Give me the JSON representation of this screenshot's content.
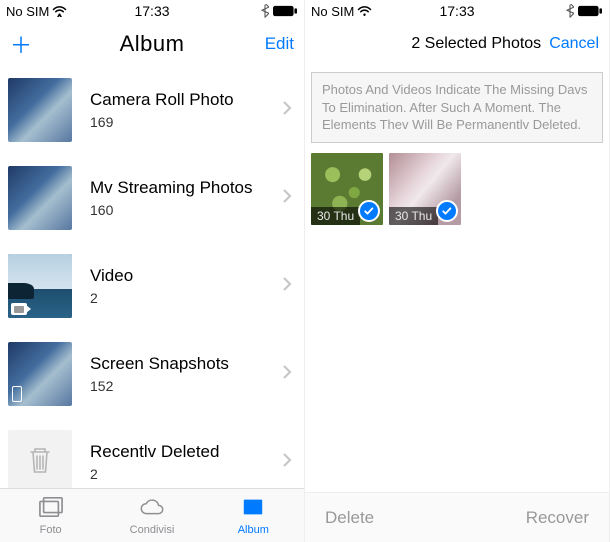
{
  "left": {
    "status": {
      "carrier": "No SIM",
      "time": "17:33"
    },
    "nav": {
      "add": "＋",
      "title": "Album",
      "right": "Edit"
    },
    "albums": [
      {
        "title": "Camera Roll Photo",
        "count": "169"
      },
      {
        "title": "Mv Streaming Photos",
        "count": "160"
      },
      {
        "title": "Video",
        "count": "2"
      },
      {
        "title": "Screen Snapshots",
        "count": "152"
      },
      {
        "title": "Recentlv Deleted",
        "count": "2"
      }
    ],
    "tabs": {
      "foto": "Foto",
      "condivisi": "Condivisi",
      "album": "Album"
    }
  },
  "right": {
    "status": {
      "carrier": "No SIM",
      "time": "17:33"
    },
    "nav": {
      "label": "2 Selected Photos",
      "cancel": "Cancel"
    },
    "info": "Photos And Videos Indicate The Missing Davs To Elimination. After Such A Moment. The Elements Thev Will Be Permanentlv Deleted.",
    "thumbs": [
      {
        "date": "30 Thu"
      },
      {
        "date": "30 Thu"
      }
    ],
    "toolbar": {
      "delete": "Delete",
      "recover": "Recover"
    }
  }
}
